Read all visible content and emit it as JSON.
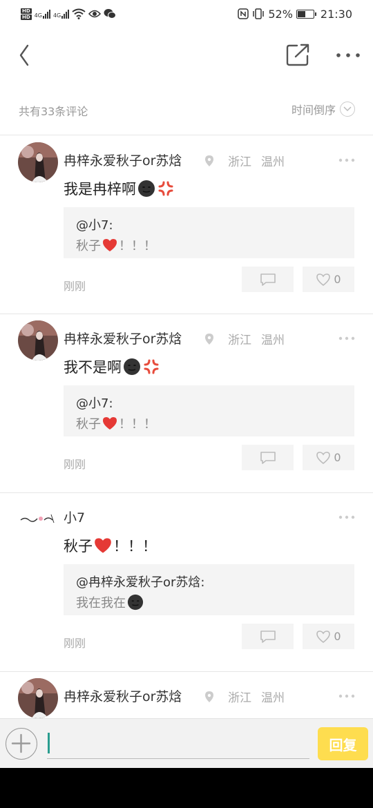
{
  "status_bar": {
    "net1": "4G",
    "net2": "4G",
    "battery": "52%",
    "time": "21:30",
    "battery_level": 0.52
  },
  "header": {
    "back_icon": "chevron-left-icon",
    "share_icon": "share-external-icon",
    "more_icon": "more-horizontal-icon"
  },
  "list_header": {
    "count_text": "共有33条评论",
    "sort_label": "时间倒序"
  },
  "comments": [
    {
      "user": "冉梓永爱秋子or苏焓",
      "loc_province": "浙江",
      "loc_city": "温州",
      "text": "我是冉梓啊",
      "quote_user": "@小7:",
      "quote_text": "秋子",
      "quote_suffix": "！！！",
      "time": "刚刚",
      "likes": "0"
    },
    {
      "user": "冉梓永爱秋子or苏焓",
      "loc_province": "浙江",
      "loc_city": "温州",
      "text": "我不是啊",
      "quote_user": "@小7:",
      "quote_text": "秋子",
      "quote_suffix": "！！！",
      "time": "刚刚",
      "likes": "0"
    },
    {
      "user": "小7",
      "text": "秋子",
      "text_suffix": "！！！",
      "quote_user": "@冉梓永爱秋子or苏焓:",
      "quote_text": "我在我在",
      "time": "刚刚",
      "likes": "0"
    },
    {
      "user": "冉梓永爱秋子or苏焓",
      "loc_province": "浙江",
      "loc_city": "温州"
    }
  ],
  "input_bar": {
    "send_label": "回复"
  },
  "colors": {
    "accent_yellow": "#fedd4f",
    "caret": "#2a9d8f",
    "meta_gray": "#aaaaaa"
  }
}
